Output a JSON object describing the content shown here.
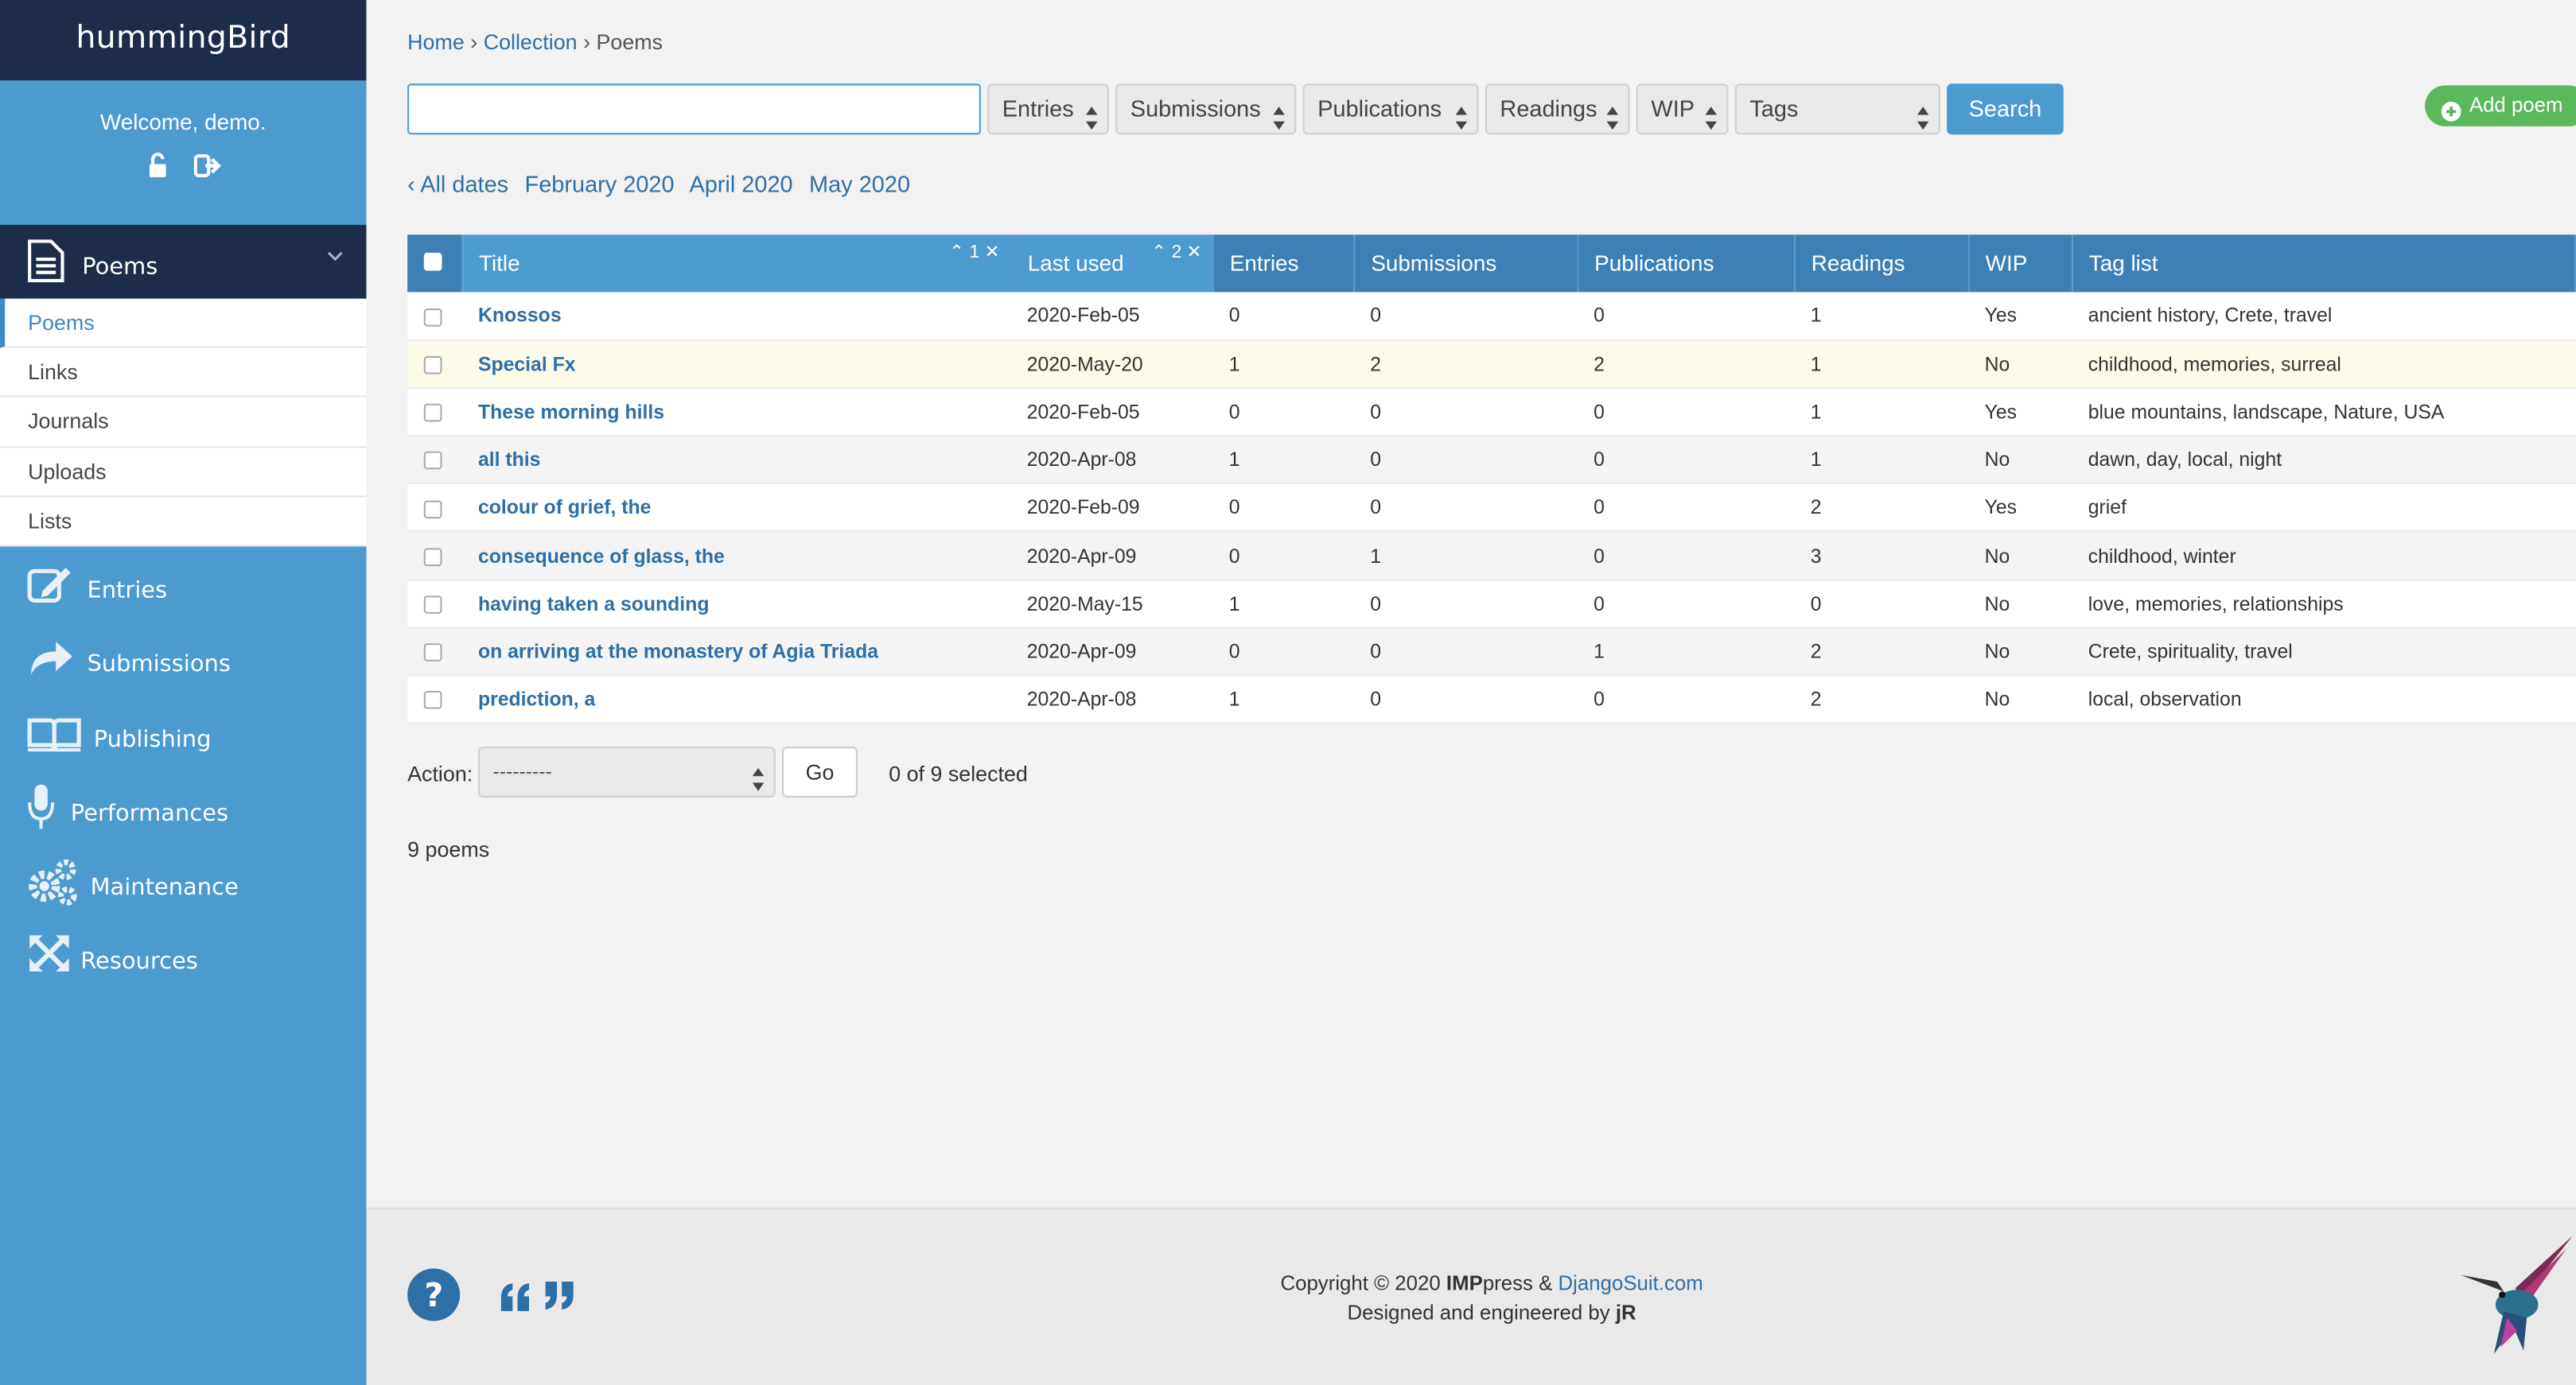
{
  "brand": "hummingBird",
  "welcome": "Welcome, demo.",
  "sidebar": {
    "active_section": "Poems",
    "sub_items": [
      "Poems",
      "Links",
      "Journals",
      "Uploads",
      "Lists"
    ],
    "nav_items": [
      "Entries",
      "Submissions",
      "Publishing",
      "Performances",
      "Maintenance",
      "Resources"
    ]
  },
  "breadcrumb": {
    "home": "Home",
    "collection": "Collection",
    "current": "Poems"
  },
  "search": {
    "value": "",
    "button": "Search"
  },
  "filters": [
    "Entries",
    "Submissions",
    "Publications",
    "Readings",
    "WIP",
    "Tags"
  ],
  "add_poem": "Add poem",
  "dates": [
    "‹ All dates",
    "February 2020",
    "April 2020",
    "May 2020"
  ],
  "table": {
    "headers": [
      "Title",
      "Last used",
      "Entries",
      "Submissions",
      "Publications",
      "Readings",
      "WIP",
      "Tag list"
    ],
    "sort_title": "1",
    "sort_last_used": "2",
    "rows": [
      [
        "Knossos",
        "2020-Feb-05",
        "0",
        "0",
        "0",
        "1",
        "Yes",
        "ancient history, Crete, travel"
      ],
      [
        "Special Fx",
        "2020-May-20",
        "1",
        "2",
        "2",
        "1",
        "No",
        "childhood, memories, surreal"
      ],
      [
        "These morning hills",
        "2020-Feb-05",
        "0",
        "0",
        "0",
        "1",
        "Yes",
        "blue mountains, landscape, Nature, USA"
      ],
      [
        "all this",
        "2020-Apr-08",
        "1",
        "0",
        "0",
        "1",
        "No",
        "dawn, day, local, night"
      ],
      [
        "colour of grief, the",
        "2020-Feb-09",
        "0",
        "0",
        "0",
        "2",
        "Yes",
        "grief"
      ],
      [
        "consequence of glass, the",
        "2020-Apr-09",
        "0",
        "1",
        "0",
        "3",
        "No",
        "childhood, winter"
      ],
      [
        "having taken a sounding",
        "2020-May-15",
        "1",
        "0",
        "0",
        "0",
        "No",
        "love, memories, relationships"
      ],
      [
        "on arriving at the monastery of Agia Triada",
        "2020-Apr-09",
        "0",
        "0",
        "1",
        "2",
        "No",
        "Crete, spirituality, travel"
      ],
      [
        "prediction, a",
        "2020-Apr-08",
        "1",
        "0",
        "0",
        "2",
        "No",
        "local, observation"
      ]
    ]
  },
  "action": {
    "label": "Action:",
    "selected": "---------",
    "go": "Go",
    "selected_count": "0 of 9 selected"
  },
  "total": "9 poems",
  "footer": {
    "line1_prefix": "Copyright © 2020 ",
    "line1_bold": "IMP",
    "line1_mid": "press & ",
    "line1_link": "DjangoSuit.com",
    "line2_prefix": "Designed and engineered by ",
    "line2_bold": "jR"
  },
  "colors": {
    "sidebar": "#4b9bd0",
    "navy": "#1e2c4c",
    "header": "#3d80b7",
    "link": "#2d6fa7",
    "add": "#5cb85c"
  }
}
